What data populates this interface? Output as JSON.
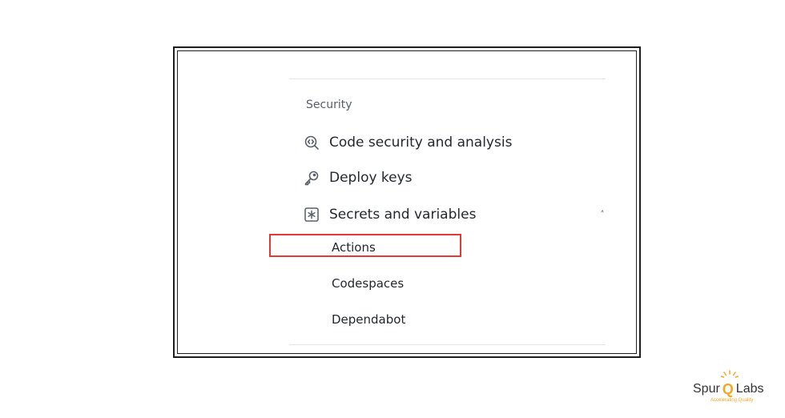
{
  "settings_nav": {
    "section_title": "Security",
    "items": [
      {
        "label": "Code security and analysis",
        "icon": "codescan-icon"
      },
      {
        "label": "Deploy keys",
        "icon": "key-icon"
      },
      {
        "label": "Secrets and variables",
        "icon": "asterisk-box-icon"
      }
    ],
    "secrets_subitems": [
      {
        "label": "Actions"
      },
      {
        "label": "Codespaces"
      },
      {
        "label": "Dependabot"
      }
    ]
  },
  "annotation": {
    "highlight_color": "#e53935",
    "highlighted_item": "Actions"
  },
  "logo": {
    "text_before": "Spur",
    "q_letter": "Q",
    "text_after": "Labs",
    "tagline": "Accelerating Quality",
    "accent_color": "#f5a623"
  }
}
